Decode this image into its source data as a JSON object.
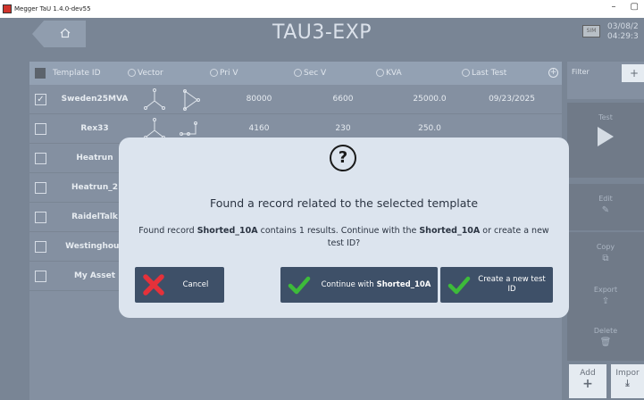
{
  "window": {
    "title": "Megger TaU 1.4.0-dev55",
    "minimize": "–",
    "restore": "▢"
  },
  "header": {
    "title": "TAU3-EXP",
    "sim_badge": "SIM",
    "datetime": "03/08/2\n04:29:3"
  },
  "table": {
    "columns": [
      "Template ID",
      "Vector",
      "Pri V",
      "Sec V",
      "KVA",
      "Last Test"
    ],
    "rows": [
      {
        "checked": true,
        "id": "Sweden25MVA",
        "pri_v": "80000",
        "sec_v": "6600",
        "kva": "25000.0",
        "last_test": "09/23/2025"
      },
      {
        "checked": false,
        "id": "Rex33",
        "pri_v": "4160",
        "sec_v": "230",
        "kva": "250.0",
        "last_test": ""
      },
      {
        "checked": false,
        "id": "Heatrun",
        "pri_v": "",
        "sec_v": "",
        "kva": "",
        "last_test": ""
      },
      {
        "checked": false,
        "id": "Heatrun_2",
        "pri_v": "",
        "sec_v": "",
        "kva": "",
        "last_test": ""
      },
      {
        "checked": false,
        "id": "RaidelTalk",
        "pri_v": "",
        "sec_v": "",
        "kva": "",
        "last_test": ""
      },
      {
        "checked": false,
        "id": "Westinghous",
        "pri_v": "",
        "sec_v": "",
        "kva": "",
        "last_test": ""
      },
      {
        "checked": false,
        "id": "My Asset",
        "pri_v": "",
        "sec_v": "",
        "kva": "",
        "last_test": ""
      }
    ]
  },
  "sidebar": {
    "filter_label": "Filter",
    "filter_add": "+",
    "test": "Test",
    "edit": "Edit",
    "copy": "Copy",
    "export": "Export",
    "delete": "Delete",
    "add": "Add",
    "import": "Impor"
  },
  "dialog": {
    "icon": "?",
    "heading": "Found a record related to the selected template",
    "msg_prefix": "Found record ",
    "record_name": "Shorted_10A",
    "msg_middle": " contains 1 results. Continue with the ",
    "msg_suffix": " or create a new test ID?",
    "cancel_label": "Cancel",
    "continue_prefix": "Continue with ",
    "create_label": "Create a new test ID"
  },
  "colors": {
    "app_bg": "#3a4b62",
    "dialog_bg": "#dce4ee",
    "button_bg": "#3e5068",
    "cancel_red": "#e5313a",
    "confirm_green": "#3dbb3a"
  }
}
